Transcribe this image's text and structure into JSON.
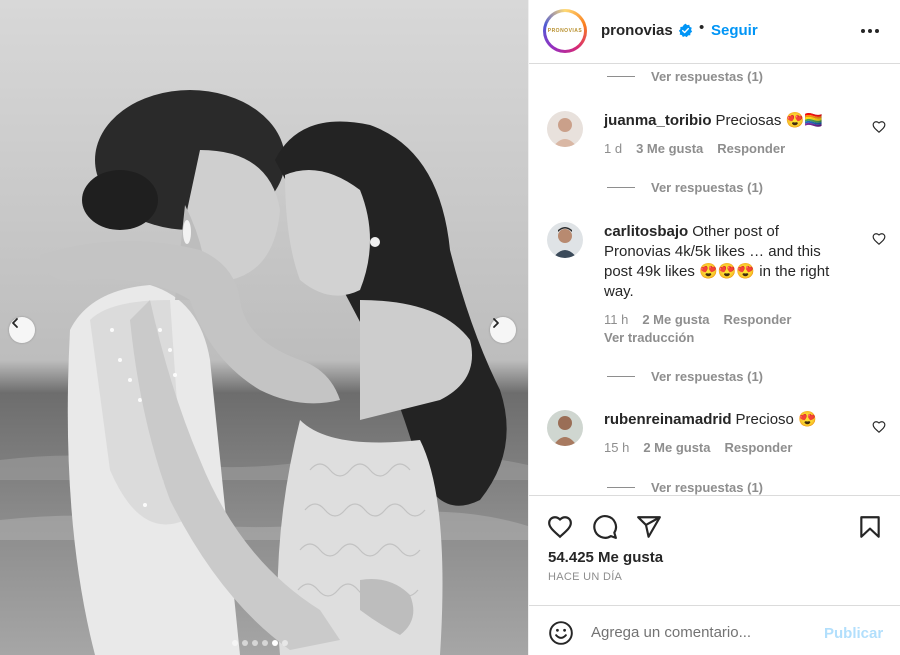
{
  "post": {
    "carousel": {
      "slide_count": 6,
      "active_slide": 5
    },
    "username": "pronovias",
    "brand_logo_text": "PRONOVIAS",
    "separator": "•",
    "follow_label": "Seguir",
    "likes": "54.425 Me gusta",
    "date": "HACE UN DÍA",
    "add_comment_placeholder": "Agrega un comentario...",
    "publish_label": "Publicar"
  },
  "comments": [
    {
      "replies_label_above": "Ver respuestas (1)",
      "user": "juanma_toribio",
      "text": "Preciosas 😍🏳️‍🌈",
      "time": "1 d",
      "likes": "3 Me gusta",
      "reply": "Responder",
      "replies_label": "Ver respuestas (1)"
    },
    {
      "user": "carlitosbajo",
      "text": "Other post of Pronovias 4k/5k likes … and this post 49k likes 😍😍😍 in the right way.",
      "time": "11 h",
      "likes": "2 Me gusta",
      "reply": "Responder",
      "translate": "Ver traducción",
      "replies_label": "Ver respuestas (1)"
    },
    {
      "user": "rubenreinamadrid",
      "text": "Precioso 😍",
      "time": "15 h",
      "likes": "2 Me gusta",
      "reply": "Responder",
      "replies_label": "Ver respuestas (1)"
    }
  ],
  "icons": {
    "verified": "verified-badge-icon",
    "more": "more-options-icon",
    "like": "heart-icon",
    "comment": "comment-icon",
    "share": "share-icon",
    "save": "bookmark-icon",
    "emoji": "emoji-icon",
    "prev": "chevron-left-icon",
    "next": "chevron-right-icon"
  },
  "colors": {
    "accent": "#0095f6",
    "muted": "#8e8e8e",
    "publish_disabled": "#b2dffc"
  }
}
